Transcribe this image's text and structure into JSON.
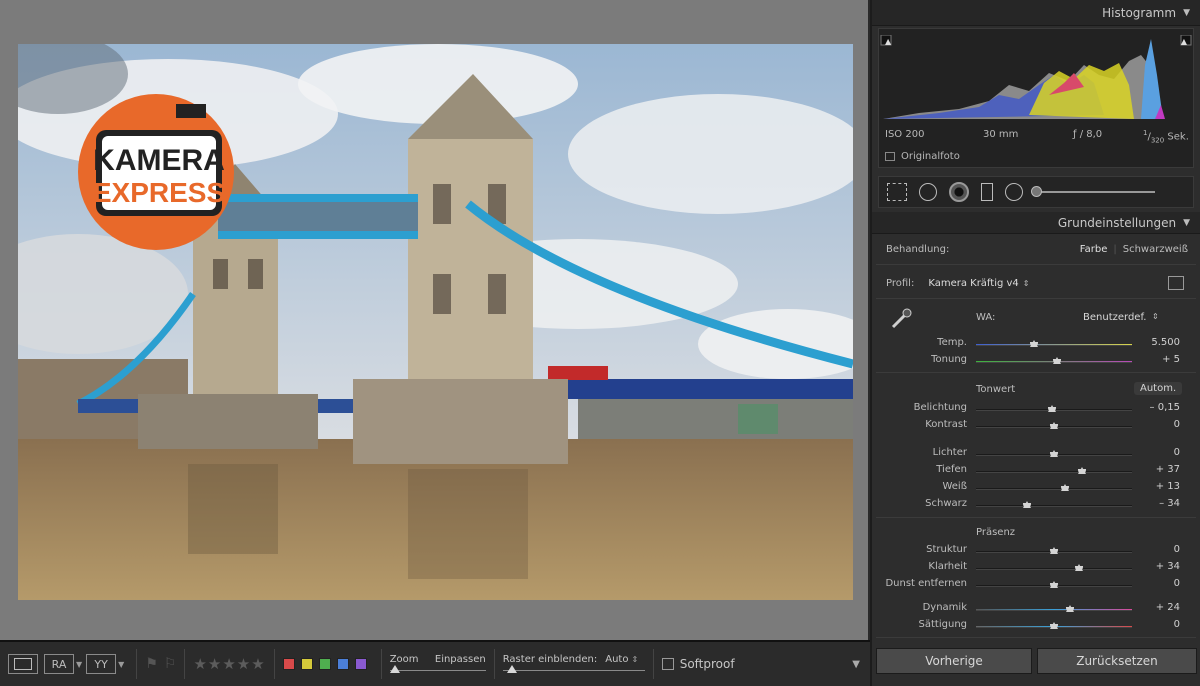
{
  "photo": {
    "logo_line1": "KAMERA",
    "logo_line2": "EXPRESS",
    "sky_color": "#7aa6cf",
    "water_color": "#a08256",
    "bridge_blue": "#2c9fd0"
  },
  "toolbar": {
    "ra_label": "RA",
    "yy_label": "YY",
    "stars": [
      "★",
      "★",
      "★",
      "★",
      "★"
    ],
    "color_labels": [
      "#d84a4a",
      "#d4c93a",
      "#4fae4f",
      "#4b7fd8",
      "#8a5ad0"
    ],
    "zoom_label": "Zoom",
    "zoom_value": "Einpassen",
    "grid_label": "Raster einblenden:",
    "grid_value": "Auto",
    "softproof_label": "Softproof"
  },
  "histogram": {
    "title": "Histogramm",
    "iso": "ISO 200",
    "focal": "30 mm",
    "aperture": "ƒ / 8,0",
    "shutter_num": "1",
    "shutter_den": "320",
    "shutter_unit": "Sek.",
    "original_label": "Originalfoto"
  },
  "basic": {
    "title": "Grundeinstellungen",
    "treatment_label": "Behandlung:",
    "treatment_color": "Farbe",
    "treatment_bw": "Schwarzweiß",
    "profile_label": "Profil:",
    "profile_value": "Kamera Kräftig v4",
    "wb_label": "WA:",
    "wb_value": "Benutzerdef.",
    "tone_title": "Tonwert",
    "auto_button": "Autom.",
    "presence_title": "Präsenz",
    "sliders_wb": [
      {
        "label": "Temp.",
        "value": "5.500",
        "pos": 0.37
      },
      {
        "label": "Tonung",
        "value": "+ 5",
        "pos": 0.52
      }
    ],
    "sliders_tone": [
      {
        "label": "Belichtung",
        "value": "– 0,15",
        "pos": 0.49
      },
      {
        "label": "Kontrast",
        "value": "0",
        "pos": 0.5
      }
    ],
    "sliders_tone2": [
      {
        "label": "Lichter",
        "value": "0",
        "pos": 0.5
      },
      {
        "label": "Tiefen",
        "value": "+ 37",
        "pos": 0.68
      },
      {
        "label": "Weiß",
        "value": "+ 13",
        "pos": 0.57
      },
      {
        "label": "Schwarz",
        "value": "– 34",
        "pos": 0.33
      }
    ],
    "sliders_presence": [
      {
        "label": "Struktur",
        "value": "0",
        "pos": 0.5
      },
      {
        "label": "Klarheit",
        "value": "+ 34",
        "pos": 0.66
      },
      {
        "label": "Dunst entfernen",
        "value": "0",
        "pos": 0.5
      }
    ],
    "sliders_color": [
      {
        "label": "Dynamik",
        "value": "+ 24",
        "pos": 0.6
      },
      {
        "label": "Sättigung",
        "value": "0",
        "pos": 0.5
      }
    ]
  },
  "buttons": {
    "previous": "Vorherige",
    "reset": "Zurücksetzen"
  }
}
